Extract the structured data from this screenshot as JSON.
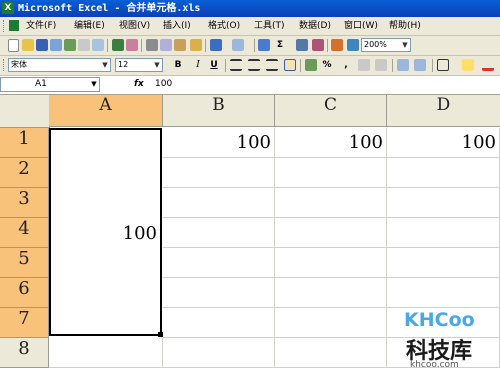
{
  "window": {
    "title": "Microsoft Excel - 合并单元格.xls"
  },
  "menu": {
    "items": [
      {
        "label": "文件(F)"
      },
      {
        "label": "编辑(E)"
      },
      {
        "label": "视图(V)"
      },
      {
        "label": "插入(I)"
      },
      {
        "label": "格式(O)"
      },
      {
        "label": "工具(T)"
      },
      {
        "label": "数据(D)"
      },
      {
        "label": "窗口(W)"
      },
      {
        "label": "帮助(H)"
      }
    ]
  },
  "toolbar": {
    "zoom": "200%",
    "sigma": "Σ"
  },
  "format_toolbar": {
    "font": "宋体",
    "size": "12",
    "bold": "B",
    "italic": "I",
    "underline": "U",
    "percent": "%",
    "comma": ","
  },
  "formula_bar": {
    "name_box": "A1",
    "fx": "fx",
    "value": "100"
  },
  "sheet": {
    "columns": [
      "A",
      "B",
      "C",
      "D"
    ],
    "rows": [
      "1",
      "2",
      "3",
      "4",
      "5",
      "6",
      "7",
      "8"
    ],
    "selected_column": "A",
    "merged_cell": {
      "range": "A1:A7",
      "value": "100"
    },
    "cells": {
      "B1": "100",
      "C1": "100",
      "D1": "100"
    }
  },
  "watermark": {
    "logo": "KHCoo",
    "name": "科技库",
    "url": "khcoo.com"
  },
  "colors": {
    "title_bar": "#0b4ec6",
    "selected_header": "#f9c27a",
    "chrome": "#ece9d8"
  }
}
